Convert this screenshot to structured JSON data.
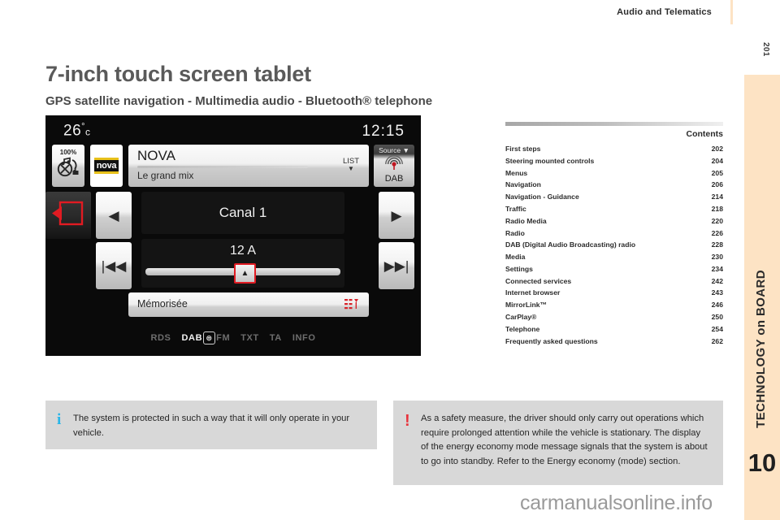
{
  "running_head": "Audio and Telematics",
  "vertical_page_number": "201",
  "sidebar": {
    "section_label": "TECHNOLOGY on BOARD",
    "chapter_number": "10",
    "color": "#fde3c4"
  },
  "page_title": "7-inch touch screen tablet",
  "page_subtitle": "GPS satellite navigation - Multimedia audio - Bluetooth® telephone",
  "contents": {
    "heading": "Contents",
    "entries": [
      {
        "title": "First steps",
        "page": "202"
      },
      {
        "title": "Steering mounted controls",
        "page": "204"
      },
      {
        "title": "Menus",
        "page": "205"
      },
      {
        "title": "Navigation",
        "page": "206"
      },
      {
        "title": "Navigation - Guidance",
        "page": "214"
      },
      {
        "title": "Traffic",
        "page": "218"
      },
      {
        "title": "Radio Media",
        "page": "220"
      },
      {
        "title": "Radio",
        "page": "226"
      },
      {
        "title": "DAB (Digital Audio Broadcasting) radio",
        "page": "228"
      },
      {
        "title": "Media",
        "page": "230"
      },
      {
        "title": "Settings",
        "page": "234"
      },
      {
        "title": "Connected services",
        "page": "242"
      },
      {
        "title": "Internet browser",
        "page": "243"
      },
      {
        "title": "MirrorLink™",
        "page": "246"
      },
      {
        "title": "CarPlay®",
        "page": "250"
      },
      {
        "title": "Telephone",
        "page": "254"
      },
      {
        "title": "Frequently asked questions",
        "page": "262"
      }
    ]
  },
  "tablet_screen": {
    "temperature": "26",
    "temperature_unit": "c",
    "clock": "12:15",
    "volume_percent": "100%",
    "volume_icon": "mute-music-icon",
    "station_logo": "nova",
    "now_playing": {
      "station": "NOVA",
      "text": "Le grand mix",
      "list_label": "LIST",
      "list_caret": "▼"
    },
    "source": {
      "label": "Source",
      "caret": "▼",
      "name": "DAB",
      "icon": "dab-antenna-icon"
    },
    "back_button_icon": "back-arrow-icon",
    "prev_arrow": "◀",
    "next_arrow": "▶",
    "skip_back": "|◀◀",
    "skip_forward": "▶▶|",
    "channel": "Canal 1",
    "ensemble": "12 A",
    "cursor_glyph": "▲",
    "memorised_label": "Mémorisée",
    "memorised_icon": "presets-icon",
    "status_items": [
      {
        "label": "RDS",
        "active": false
      },
      {
        "label": "DAB",
        "active": true
      },
      {
        "label": "FM",
        "active": false
      },
      {
        "label": "TXT",
        "active": false
      },
      {
        "label": "TA",
        "active": false
      },
      {
        "label": "INFO",
        "active": false
      }
    ],
    "dab_fm_box_glyph": "⊜"
  },
  "notes": {
    "info": {
      "icon": "info-icon",
      "icon_glyph": "i",
      "text": "The system is protected in such a way that it will only operate in your vehicle.",
      "color": "#29b6e8"
    },
    "warning": {
      "icon": "warning-icon",
      "icon_glyph": "!",
      "text": "As a safety measure, the driver should only carry out operations which require prolonged attention while the vehicle is stationary. The display of the energy economy mode message signals that the system is about to go into standby. Refer to the Energy economy (mode) section.",
      "color": "#e8333c"
    }
  },
  "watermark": "carmanualsonline.info"
}
